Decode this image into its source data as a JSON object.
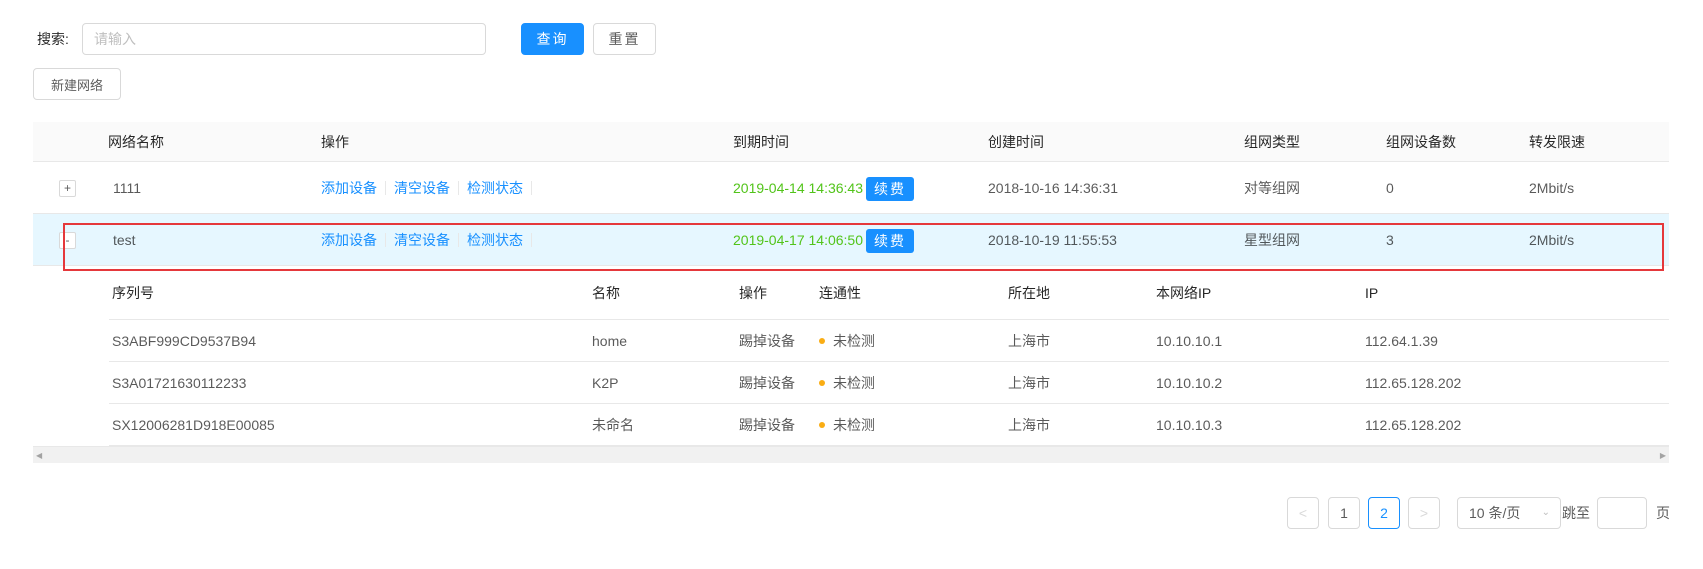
{
  "search": {
    "label": "搜索:",
    "placeholder": "请输入",
    "query_label": "查询",
    "reset_label": "重置"
  },
  "toolbar": {
    "new_network_label": "新建网络"
  },
  "table": {
    "columns": [
      "网络名称",
      "操作",
      "到期时间",
      "创建时间",
      "组网类型",
      "组网设备数",
      "转发限速"
    ],
    "op_labels": {
      "add": "添加设备",
      "clear": "清空设备",
      "check": "检测状态"
    },
    "renew_label": "续费",
    "rows": [
      {
        "expand": "+",
        "name": "1111",
        "expire": "2019-04-14 14:36:43",
        "created": "2018-10-16 14:36:31",
        "type": "对等组网",
        "devices": "0",
        "limit": "2Mbit/s",
        "selected": false
      },
      {
        "expand": "-",
        "name": "test",
        "expire": "2019-04-17 14:06:50",
        "created": "2018-10-19 11:55:53",
        "type": "星型组网",
        "devices": "3",
        "limit": "2Mbit/s",
        "selected": true
      }
    ]
  },
  "subtable": {
    "columns": [
      "序列号",
      "名称",
      "操作",
      "连通性",
      "所在地",
      "本网络IP",
      "IP"
    ],
    "kick_label": "踢掉设备",
    "rows": [
      {
        "serial": "S3ABF999CD9537B94",
        "name": "home",
        "status": "未检测",
        "location": "上海市",
        "net_ip": "10.10.10.1",
        "ip": "112.64.1.39"
      },
      {
        "serial": "S3A01721630112233",
        "name": "K2P",
        "status": "未检测",
        "location": "上海市",
        "net_ip": "10.10.10.2",
        "ip": "112.65.128.202"
      },
      {
        "serial": "SX12006281D918E00085",
        "name": "未命名",
        "status": "未检测",
        "location": "上海市",
        "net_ip": "10.10.10.3",
        "ip": "112.65.128.202"
      }
    ],
    "status_color": "#faad14"
  },
  "pagination": {
    "prev": "<",
    "pages": [
      "1",
      "2"
    ],
    "current": "2",
    "next": ">",
    "page_size": "10 条/页",
    "jump_label": "跳至",
    "page_suffix": "页"
  },
  "colors": {
    "primary": "#1890ff",
    "expire": "#52c41a",
    "highlight": "#e5383b",
    "selected_row": "#e6f7ff"
  }
}
